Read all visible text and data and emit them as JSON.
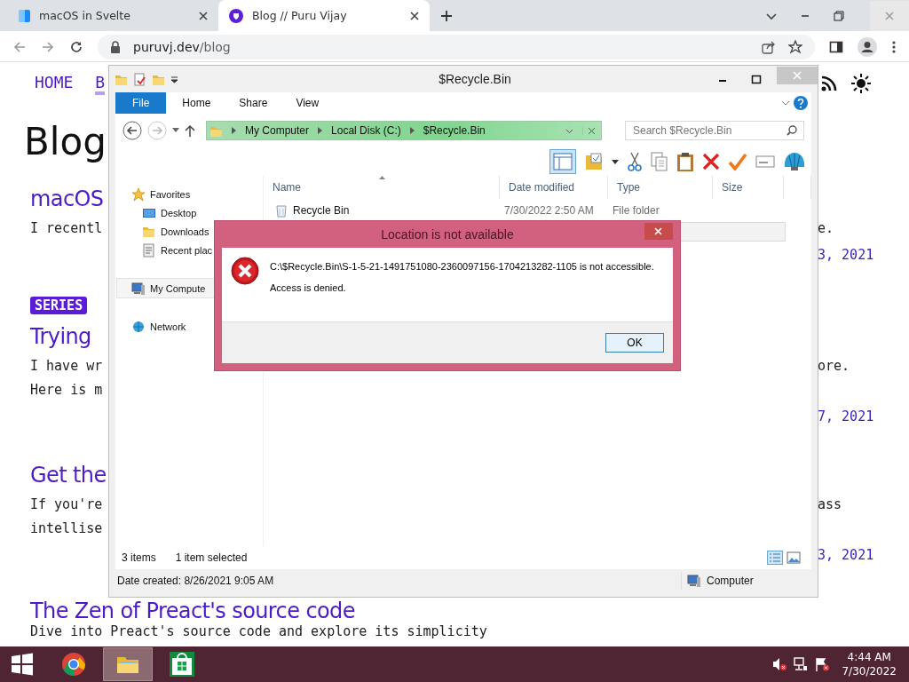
{
  "browser": {
    "tabs": [
      {
        "title": "macOS in Svelte",
        "selected": false
      },
      {
        "title": "Blog // Puru Vijay",
        "selected": true
      }
    ],
    "url": {
      "host": "puruvj.dev",
      "path": "/blog"
    }
  },
  "blog": {
    "nav": [
      {
        "label": "HOME",
        "selected": false
      },
      {
        "label": "B",
        "selected": true
      }
    ],
    "heading": "Blog",
    "posts": [
      {
        "title": "macOS",
        "lines": [
          {
            "start": "I recentl",
            "end": "e."
          }
        ],
        "date": "3, 2021"
      },
      {
        "badge": "SERIES",
        "title": "Trying",
        "lines": [
          {
            "start": "I have wr",
            "end": "ore."
          },
          {
            "start": "Here is m"
          }
        ],
        "date": "7, 2021"
      },
      {
        "title": "Get the",
        "lines": [
          {
            "start": "If you're",
            "end": "ass"
          },
          {
            "start": "intellise"
          }
        ],
        "date": "3, 2021"
      },
      {
        "title": "The Zen of Preact's source code",
        "lines": [
          {
            "start": "Dive into Preact's source code and explore its simplicity"
          }
        ]
      }
    ]
  },
  "explorer": {
    "title": "$Recycle.Bin",
    "ribbon_tabs": [
      {
        "label": "File",
        "kind": "menu"
      },
      {
        "label": "Home",
        "kind": "tab"
      },
      {
        "label": "Share",
        "kind": "tab"
      },
      {
        "label": "View",
        "kind": "tab"
      }
    ],
    "breadcrumbs": [
      "My Computer",
      "Local Disk (C:)",
      "$Recycle.Bin"
    ],
    "search": {
      "placeholder": "Search $Recycle.Bin"
    },
    "nav": [
      {
        "label": "Favorites",
        "kind": "star",
        "group": true,
        "selected": false
      },
      {
        "label": "Desktop",
        "kind": "desktop",
        "group": false,
        "selected": false
      },
      {
        "label": "Downloads",
        "kind": "folder",
        "group": false,
        "selected": false
      },
      {
        "label": "Recent plac",
        "kind": "recent",
        "group": false,
        "selected": false
      },
      {
        "label": "My Compute",
        "kind": "computer",
        "group": true,
        "selected": true
      },
      {
        "label": "Network",
        "kind": "network",
        "group": true,
        "selected": false
      }
    ],
    "columns": [
      "Name",
      "Date modified",
      "Type",
      "Size"
    ],
    "rows": [
      {
        "name": "Recycle Bin",
        "date": "7/30/2022 2:50 AM",
        "type": "File folder",
        "selected": false
      },
      {
        "selected": true
      }
    ],
    "status": {
      "count": "3 items",
      "selection": "1 item selected"
    },
    "details": {
      "created": "Date created: 8/26/2021 9:05 AM",
      "location": "Computer"
    }
  },
  "dialog": {
    "title": "Location is not available",
    "message": "C:\\$Recycle.Bin\\S-1-5-21-1491751080-2360097156-1704213282-1105 is not accessible.",
    "detail": "Access is denied.",
    "button": "OK"
  },
  "taskbar": {
    "apps": [
      {
        "kind": "chrome",
        "active": false
      },
      {
        "kind": "explorer",
        "active": true
      },
      {
        "kind": "store",
        "active": false
      }
    ],
    "time": "4:44 AM",
    "date": "7/30/2022"
  }
}
